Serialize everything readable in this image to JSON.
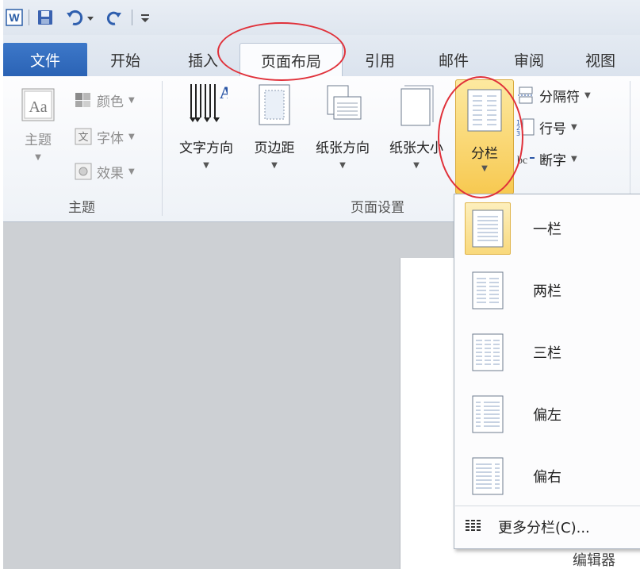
{
  "quick_access": {
    "app_icon": "word-icon",
    "items": [
      "save-icon",
      "undo-icon",
      "redo-icon",
      "customize-icon"
    ]
  },
  "tabs": {
    "file": "文件",
    "items": [
      "开始",
      "插入",
      "页面布局",
      "引用",
      "邮件",
      "审阅",
      "视图"
    ],
    "active": "页面布局"
  },
  "ribbon": {
    "themes_group": {
      "label": "主题",
      "themes_button": "主题",
      "colors": "颜色",
      "fonts": "字体",
      "effects": "效果"
    },
    "page_setup_group": {
      "label": "页面设置",
      "text_direction": "文字方向",
      "margins": "页边距",
      "orientation": "纸张方向",
      "size": "纸张大小",
      "columns": "分栏",
      "breaks": "分隔符",
      "line_numbers": "行号",
      "hyphenation": "断字"
    }
  },
  "columns_menu": {
    "items": [
      "一栏",
      "两栏",
      "三栏",
      "偏左",
      "偏右"
    ],
    "more": "更多分栏(C)...",
    "more_underline": "C"
  },
  "document": {
    "partial_text": "编辑器"
  },
  "colors": {
    "file_tab": "#2b63b5",
    "highlight": "#f7c951",
    "annotation": "#e0313a"
  }
}
